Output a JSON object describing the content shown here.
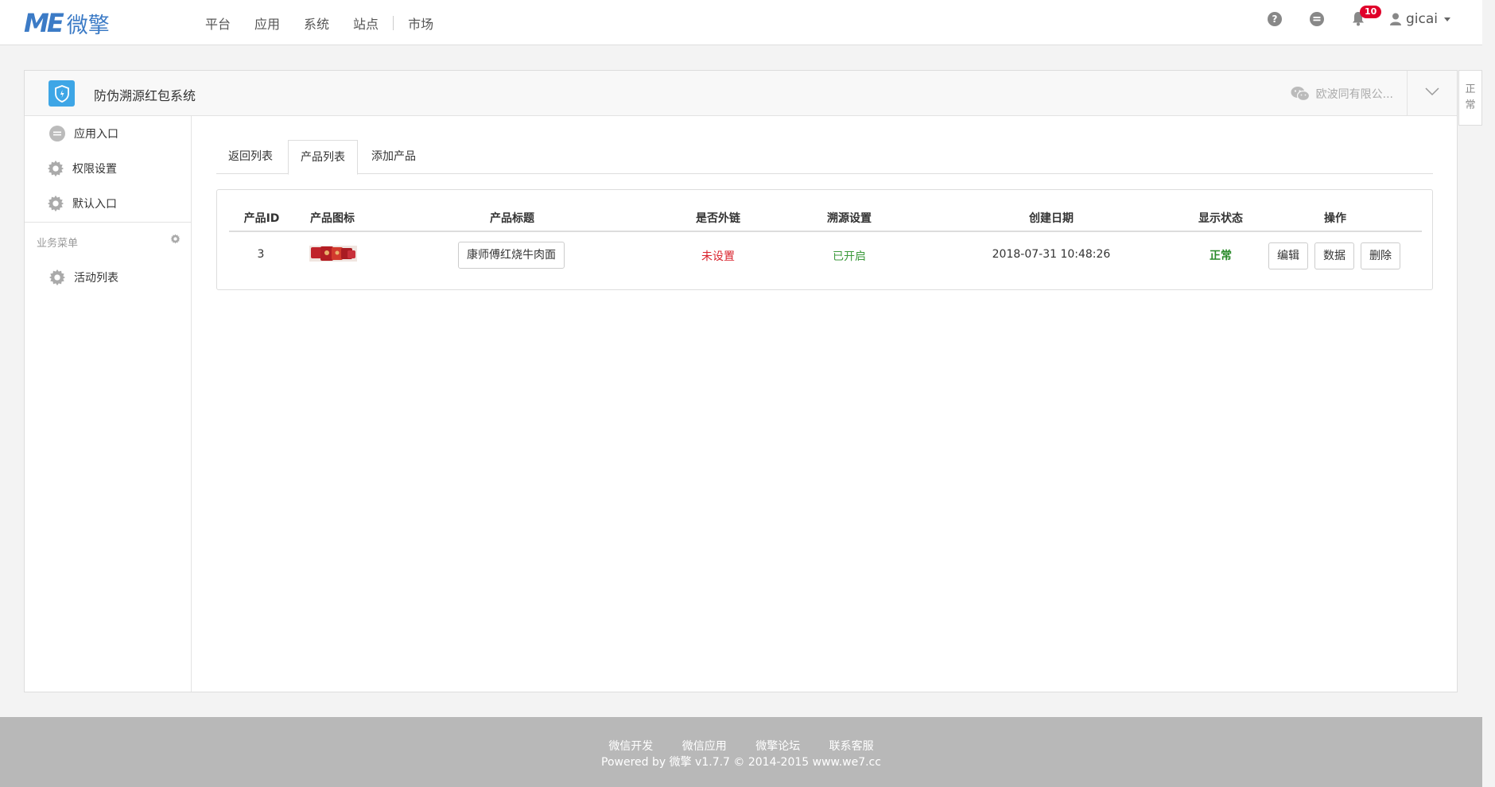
{
  "brand": {
    "logo_mark": "ME",
    "logo_text": "微擎",
    "color": "#3c7bc6"
  },
  "nav": {
    "items": [
      "平台",
      "应用",
      "系统",
      "站点",
      "市场"
    ]
  },
  "topbar": {
    "help_icon": "question-circle-icon",
    "message_icon": "chat-icon",
    "notifications_count": "10",
    "username": "gicai"
  },
  "app": {
    "title": "防伪溯源红包系统",
    "account": "欧波同有限公..."
  },
  "sidebar": {
    "items": [
      {
        "label": "应用入口",
        "icon": "comment-icon"
      },
      {
        "label": "权限设置",
        "icon": "gear-icon"
      },
      {
        "label": "默认入口",
        "icon": "gear-icon"
      }
    ],
    "group_label": "业务菜单",
    "group_items": [
      {
        "label": "活动列表",
        "icon": "gear-icon"
      }
    ]
  },
  "tabs": [
    "返回列表",
    "产品列表",
    "添加产品"
  ],
  "table": {
    "headers": [
      "产品ID",
      "产品图标",
      "产品标题",
      "是否外链",
      "溯源设置",
      "创建日期",
      "显示状态",
      "操作"
    ],
    "row": {
      "id": "3",
      "title": "康师傅红烧牛肉面",
      "external": "未设置",
      "trace": "已开启",
      "created": "2018-07-31 10:48:26",
      "status": "正常",
      "actions": [
        "编辑",
        "数据",
        "删除"
      ]
    }
  },
  "side_tag": {
    "label_1": "正",
    "label_2": "常"
  },
  "footer": {
    "links": [
      "微信开发",
      "微信应用",
      "微擎论坛",
      "联系客服"
    ],
    "copyright": "Powered by 微擎 v1.7.7 © 2014-2015 www.we7.cc"
  },
  "colors": {
    "red": "#d9232d",
    "green": "#3c9a3c",
    "status_green": "#2a8a2a",
    "app_icon": "#3ea6e6"
  }
}
